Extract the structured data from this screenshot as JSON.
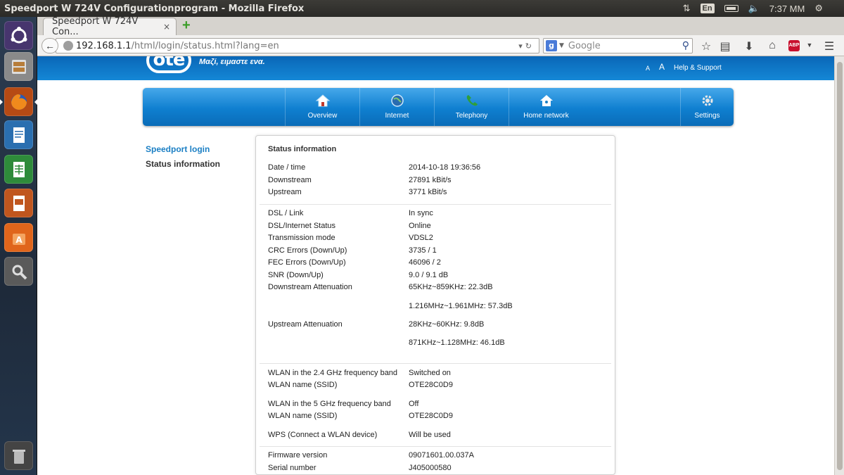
{
  "window": {
    "title": "Speedport W 724V Configurationprogram - Mozilla Firefox"
  },
  "panel_indicators": {
    "keyboard_lang": "En",
    "clock": "7:37 MM"
  },
  "launcher": {
    "items": [
      {
        "name": "ubuntu-dash",
        "icon": "ubuntu-logo-icon",
        "color": "#3b2e66"
      },
      {
        "name": "files",
        "icon": "file-cabinet-icon",
        "color": "#7a7a7a"
      },
      {
        "name": "firefox",
        "icon": "firefox-icon",
        "color": "#d35400"
      },
      {
        "name": "writer",
        "icon": "writer-document-icon",
        "color": "#2a6fb0"
      },
      {
        "name": "calc",
        "icon": "calc-spreadsheet-icon",
        "color": "#2e8b3a"
      },
      {
        "name": "impress",
        "icon": "impress-presentation-icon",
        "color": "#c0561e"
      },
      {
        "name": "software-center",
        "icon": "software-center-bag-icon",
        "color": "#e0651b"
      },
      {
        "name": "system-settings",
        "icon": "settings-wrench-icon",
        "color": "#5a5a5a"
      },
      {
        "name": "trash",
        "icon": "trash-icon",
        "color": "#555555"
      }
    ]
  },
  "browser": {
    "tab": {
      "title": "Speedport W 724V Con...",
      "close": "×"
    },
    "url": {
      "host": "192.168.1.1",
      "path": "/html/login/status.html?lang=en"
    },
    "search": {
      "engine": "g",
      "placeholder": "Google"
    },
    "abp": "ABP"
  },
  "page": {
    "header": {
      "logo": "ote",
      "slogan": "Μαζί, ειμαστε ενα.",
      "font_small": "A",
      "font_large": "A",
      "help": "Help & Support"
    },
    "nav": [
      {
        "label": "Overview",
        "icon": "house-icon"
      },
      {
        "label": "Internet",
        "icon": "globe-icon"
      },
      {
        "label": "Telephony",
        "icon": "phone-handset-icon"
      },
      {
        "label": "Home network",
        "icon": "home-network-icon"
      },
      {
        "label": "Settings",
        "icon": "gear-icon"
      }
    ],
    "sidebar": {
      "login": "Speedport login",
      "status": "Status information"
    },
    "status": {
      "title": "Status information",
      "group1": [
        {
          "label": "Date / time",
          "value": "2014-10-18 19:36:56"
        },
        {
          "label": "Downstream",
          "value": "27891 kBit/s"
        },
        {
          "label": "Upstream",
          "value": "3771 kBit/s"
        }
      ],
      "group2": [
        {
          "label": "DSL / Link",
          "value": "In sync"
        },
        {
          "label": "DSL/Internet Status",
          "value": "Online"
        },
        {
          "label": "Transmission mode",
          "value": "VDSL2"
        },
        {
          "label": "CRC Errors (Down/Up)",
          "value": "3735 / 1"
        },
        {
          "label": "FEC Errors (Down/Up)",
          "value": "46096 / 2"
        },
        {
          "label": "SNR (Down/Up)",
          "value": "9.0 / 9.1 dB"
        },
        {
          "label": "Downstream Attenuation",
          "value": "65KHz~859KHz: 22.3dB",
          "value2": "1.216MHz~1.961MHz: 57.3dB"
        },
        {
          "label": "Upstream Attenuation",
          "value": "28KHz~60KHz: 9.8dB",
          "value2": "871KHz~1.128MHz: 46.1dB"
        }
      ],
      "group3": [
        {
          "label": "WLAN in the 2.4 GHz frequency band",
          "value": "Switched on"
        },
        {
          "label": "WLAN name (SSID)",
          "value": "OTE28C0D9"
        },
        {
          "label": "WLAN in the 5 GHz frequency band",
          "value": "Off"
        },
        {
          "label": "WLAN name (SSID)",
          "value": "OTE28C0D9"
        },
        {
          "label": "WPS (Connect a WLAN device)",
          "value": "Will be used"
        }
      ],
      "group4": [
        {
          "label": "Firmware version",
          "value": "09071601.00.037A"
        },
        {
          "label": "Serial number",
          "value": "J405000580"
        }
      ]
    }
  }
}
